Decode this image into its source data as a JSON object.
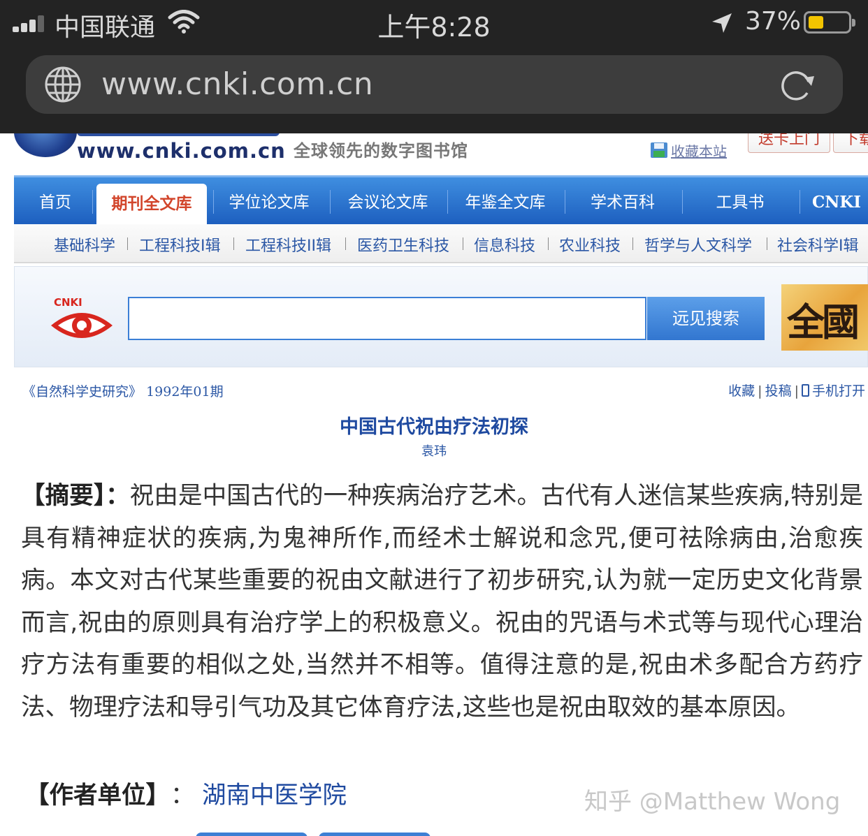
{
  "status_bar": {
    "carrier": "中国联通",
    "time": "上午8:28",
    "battery_percent": "37%",
    "battery_level": 0.37,
    "icons": [
      "signal-icon",
      "wifi-icon",
      "location-arrow-icon",
      "battery-icon"
    ]
  },
  "browser": {
    "url": "www.cnki.com.cn",
    "icons": [
      "globe-icon",
      "reload-icon"
    ]
  },
  "header": {
    "logo_url": "www.cnki.com.cn",
    "tagline": "全球领先的数字图书馆",
    "favorite_link": "收藏本站",
    "buttons": [
      "送卡上门",
      "下载"
    ]
  },
  "main_nav": {
    "items": [
      "首页",
      "期刊全文库",
      "学位论文库",
      "会议论文库",
      "年鉴全文库",
      "学术百科",
      "工具书",
      "CNKI"
    ],
    "active": "期刊全文库"
  },
  "sub_nav": {
    "items": [
      "基础科学",
      "工程科技I辑",
      "工程科技II辑",
      "医药卫生科技",
      "信息科技",
      "农业科技",
      "哲学与人文科学",
      "社会科学I辑"
    ]
  },
  "search": {
    "logo_text": "CNKI",
    "input_value": "",
    "button_label": "远见搜索",
    "banner_text": "全國"
  },
  "article": {
    "journal": "《自然科学史研究》",
    "issue": "1992年01期",
    "actions": [
      "收藏",
      "投稿",
      "手机打开"
    ],
    "title": "中国古代祝由疗法初探",
    "author": "袁玮",
    "abstract_label": "【摘要】：",
    "abstract_text": "祝由是中国古代的一种疾病治疗艺术。古代有人迷信某些疾病,特别是具有精神症状的疾病,为鬼神所作,而经术士解说和念咒,便可祛除病由,治愈疾病。本文对古代某些重要的祝由文献进行了初步研究,认为就一定历史文化背景而言,祝由的原则具有治疗学上的积极意义。祝由的咒语与术式等与现代心理治疗方法有重要的相似之处,当然并不相等。值得注意的是,祝由术多配合方药疗法、物理疗法和导引气功及其它体育疗法,这些也是祝由取效的基本原因。",
    "affiliation_label": "【作者单位】",
    "affiliation_colon": "：",
    "affiliation_value": "湖南中医学院"
  },
  "watermark": "知乎 @Matthew Wong",
  "colors": {
    "nav_blue": "#2a6fcf",
    "active_tab_text": "#d2452b",
    "link_blue": "#2b57a5",
    "title_blue": "#1f4aa0",
    "chrome_dark": "#232323",
    "battery_yellow": "#f3c400"
  }
}
